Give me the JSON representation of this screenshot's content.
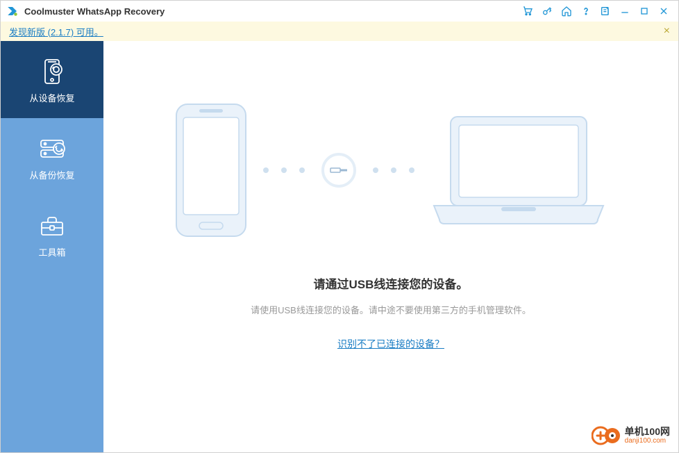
{
  "app": {
    "title": "Coolmuster WhatsApp Recovery"
  },
  "banner": {
    "text": "发现新版 (2.1.7) 可用。"
  },
  "sidebar": {
    "items": [
      {
        "label": "从设备恢复"
      },
      {
        "label": "从备份恢复"
      },
      {
        "label": "工具箱"
      }
    ]
  },
  "content": {
    "main_text": "请通过USB线连接您的设备。",
    "sub_text": "请使用USB线连接您的设备。请中途不要使用第三方的手机管理软件。",
    "help_link": "识别不了已连接的设备？"
  },
  "watermark": {
    "main": "单机100网",
    "sub": "danji100.com"
  }
}
